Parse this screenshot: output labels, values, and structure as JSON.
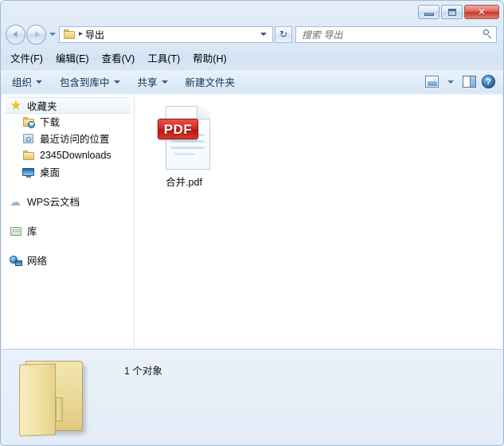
{
  "window": {
    "buttons": {
      "minimize": "最小化",
      "maximize": "最大化",
      "close": "✕"
    }
  },
  "address_bar": {
    "back": "后退",
    "forward": "前进",
    "folder_icon": "folder-icon",
    "separator": "▸",
    "path": "导出",
    "dropdown": "▾",
    "refresh": "↻"
  },
  "search": {
    "placeholder": "搜索 导出",
    "icon": "search-icon"
  },
  "menu": {
    "items": [
      {
        "label": "文件(F)"
      },
      {
        "label": "编辑(E)"
      },
      {
        "label": "查看(V)"
      },
      {
        "label": "工具(T)"
      },
      {
        "label": "帮助(H)"
      }
    ]
  },
  "toolbar": {
    "organize": "组织",
    "include_in_library": "包含到库中",
    "share": "共享",
    "new_folder": "新建文件夹",
    "view_icon": "view-mode-icon",
    "view_caret": "▾",
    "preview_pane_icon": "preview-pane-icon",
    "help_icon": "?"
  },
  "sidebar": {
    "items": [
      {
        "label": "收藏夹",
        "icon": "star-icon",
        "selected": true
      },
      {
        "label": "下载",
        "icon": "downloads-icon",
        "selected": false
      },
      {
        "label": "最近访问的位置",
        "icon": "recent-places-icon",
        "selected": false
      },
      {
        "label": "2345Downloads",
        "icon": "folder-icon",
        "selected": false
      },
      {
        "label": "桌面",
        "icon": "desktop-icon",
        "selected": false
      },
      {
        "label": "WPS云文档",
        "icon": "cloud-icon",
        "selected": false
      },
      {
        "label": "库",
        "icon": "library-icon",
        "selected": false
      },
      {
        "label": "网络",
        "icon": "network-icon",
        "selected": false
      }
    ]
  },
  "files": [
    {
      "name": "合并.pdf",
      "type": "pdf",
      "badge": "PDF"
    }
  ],
  "details_pane": {
    "folder_icon": "folder-icon",
    "status": "1 个对象"
  },
  "watermark": {
    "line1": "水印",
    "line2": "水印文字"
  },
  "colors": {
    "pdf_red": "#d22a22",
    "frame_blue": "#dbe8f6",
    "accent": "#2f5a86"
  }
}
